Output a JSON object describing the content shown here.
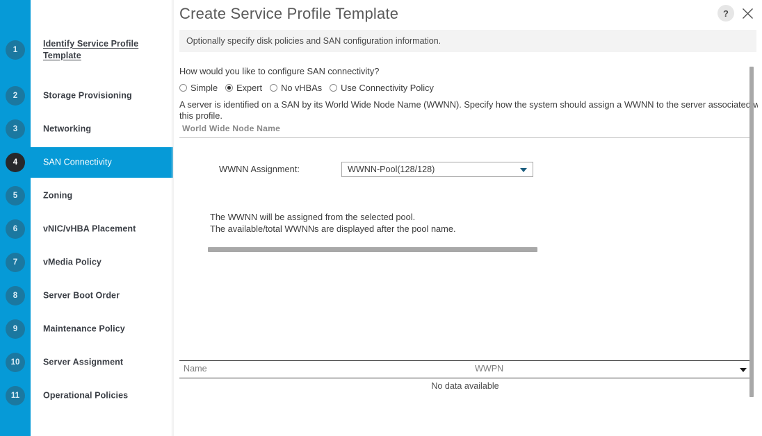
{
  "window": {
    "title": "Create Service Profile Template",
    "help_label": "?",
    "close_label": "close-icon",
    "subheader": "Optionally specify disk policies and SAN configuration information."
  },
  "sidebar": {
    "steps": [
      {
        "number": "1",
        "label": "Identify Service Profile Template",
        "active": false
      },
      {
        "number": "2",
        "label": "Storage Provisioning",
        "active": false
      },
      {
        "number": "3",
        "label": "Networking",
        "active": false
      },
      {
        "number": "4",
        "label": "SAN Connectivity",
        "active": true
      },
      {
        "number": "5",
        "label": "Zoning",
        "active": false
      },
      {
        "number": "6",
        "label": "vNIC/vHBA Placement",
        "active": false
      },
      {
        "number": "7",
        "label": "vMedia Policy",
        "active": false
      },
      {
        "number": "8",
        "label": "Server Boot Order",
        "active": false
      },
      {
        "number": "9",
        "label": "Maintenance Policy",
        "active": false
      },
      {
        "number": "10",
        "label": "Server Assignment",
        "active": false
      },
      {
        "number": "11",
        "label": "Operational Policies",
        "active": false
      }
    ]
  },
  "main": {
    "question": "How would you like to configure SAN connectivity?",
    "connectivity_options": [
      {
        "label": "Simple",
        "selected": false
      },
      {
        "label": "Expert",
        "selected": true
      },
      {
        "label": "No vHBAs",
        "selected": false
      },
      {
        "label": "Use Connectivity Policy",
        "selected": false
      }
    ],
    "description_line1": "A server is identified on a SAN by its World Wide Node Name (WWNN). Specify how the system should assign a WWNN to the server associated with",
    "description_line2": "this profile.",
    "section_title": "World Wide Node Name",
    "wwnn_assignment_label": "WWNN Assignment:",
    "wwnn_assignment_value": "WWNN-Pool(128/128)",
    "help_line1": "The WWNN will be assigned from the selected pool.",
    "help_line2": "The available/total WWNNs are displayed after the pool name.",
    "table": {
      "columns": [
        "Name",
        "WWPN"
      ],
      "empty_message": "No data available"
    }
  },
  "colors": {
    "accent_blue": "#069ad7",
    "bubble_inactive": "#1b78a0",
    "bubble_active": "#27282b",
    "subheader_bg": "#f3f3f3"
  }
}
